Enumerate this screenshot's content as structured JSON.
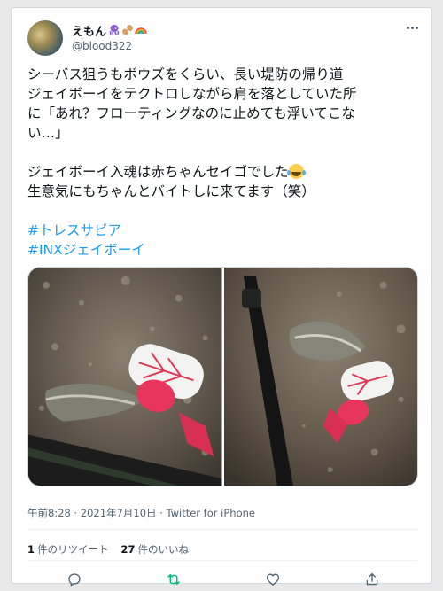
{
  "author": {
    "display_name": "えもん",
    "handle": "@blood322",
    "name_emojis": [
      "octopus-icon",
      "peanut-icon",
      "rainbow-icon"
    ]
  },
  "tweet": {
    "lines": [
      "シーバス狙うもボウズをくらい、長い堤防の帰り道",
      "ジェイボーイをテクトロしながら肩を落としていた所",
      "に「あれ？フローティングなのに止めても浮いてこな",
      "い…」",
      "",
      "ジェイボーイ入魂は赤ちゃんセイゴでした",
      "生意気にもちゃんとバイトしに来てます（笑）",
      "",
      "#トレスサビア",
      "#INXジェイボーイ"
    ]
  },
  "meta": {
    "time": "午前8:28",
    "separator": "·",
    "date": "2021年7月10日",
    "client": "Twitter for iPhone"
  },
  "stats": {
    "retweets_count": "1",
    "retweets_label": "件のリツイート",
    "likes_count": "27",
    "likes_label": "件のいいね"
  },
  "colors": {
    "link": "#1d9bf0",
    "retweet_active": "#00ba7c",
    "secondary_text": "#536471"
  }
}
